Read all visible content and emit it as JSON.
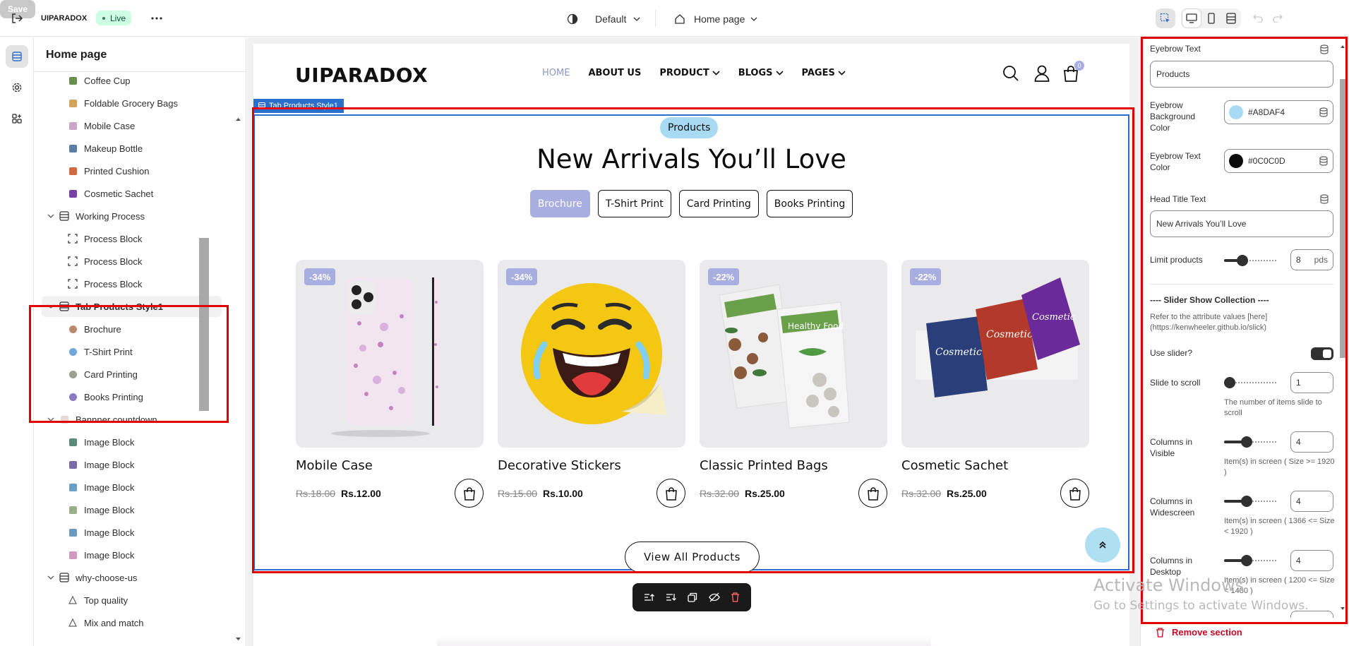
{
  "topbar": {
    "store_name": "UIPARADOX",
    "live_label": "Live",
    "theme_label": "Default",
    "page_label": "Home page",
    "save_label": "Save",
    "more_icon": "more-icon"
  },
  "sidebar": {
    "title": "Home page",
    "items": [
      {
        "label": "Coffee Cup",
        "level": 2,
        "thumb": "#6a8f4c"
      },
      {
        "label": "Foldable Grocery Bags",
        "level": 2,
        "thumb": "#d4a35b"
      },
      {
        "label": "Mobile Case",
        "level": 2,
        "thumb": "#c9a6c8"
      },
      {
        "label": "Makeup Bottle",
        "level": 2,
        "thumb": "#5b7fa3"
      },
      {
        "label": "Printed Cushion",
        "level": 2,
        "thumb": "#d06a3f"
      },
      {
        "label": "Cosmetic Sachet",
        "level": 2,
        "thumb": "#7a3fa3"
      },
      {
        "label": "Working Process",
        "level": 1,
        "icon": "section-icon"
      },
      {
        "label": "Process Block",
        "level": 2,
        "icon": "block-icon"
      },
      {
        "label": "Process Block",
        "level": 2,
        "icon": "block-icon"
      },
      {
        "label": "Process Block",
        "level": 2,
        "icon": "block-icon"
      },
      {
        "label": "Tab Products Style1",
        "level": 1,
        "icon": "section-icon",
        "selected": true
      },
      {
        "label": "Brochure",
        "level": 2,
        "thumb": "#b98a6e"
      },
      {
        "label": "T-Shirt Print",
        "level": 2,
        "thumb": "#6fa7d8"
      },
      {
        "label": "Card Printing",
        "level": 2,
        "thumb": "#9aa08c"
      },
      {
        "label": "Books Printing",
        "level": 2,
        "thumb": "#8a78c4"
      },
      {
        "label": "Bannner countdown",
        "level": 1,
        "thumb": "#e7d8d8"
      },
      {
        "label": "Image Block",
        "level": 2,
        "thumb": "#5a8a7a"
      },
      {
        "label": "Image Block",
        "level": 2,
        "thumb": "#7a6aa8"
      },
      {
        "label": "Image Block",
        "level": 2,
        "thumb": "#6aa0c8"
      },
      {
        "label": "Image Block",
        "level": 2,
        "thumb": "#9ab08a"
      },
      {
        "label": "Image Block",
        "level": 2,
        "thumb": "#6a9ac0"
      },
      {
        "label": "Image Block",
        "level": 2,
        "thumb": "#d09ac0"
      },
      {
        "label": "why-choose-us",
        "level": 1,
        "icon": "section-icon"
      },
      {
        "label": "Top quality",
        "level": 2,
        "icon": "shape-icon"
      },
      {
        "label": "Mix and match",
        "level": 2,
        "icon": "shape-icon"
      }
    ]
  },
  "preview": {
    "logo": "UIPARADOX",
    "nav": [
      {
        "label": "HOME",
        "active": true,
        "dropdown": false
      },
      {
        "label": "ABOUT US",
        "active": false,
        "dropdown": false
      },
      {
        "label": "PRODUCT",
        "active": false,
        "dropdown": true
      },
      {
        "label": "BLOGS",
        "active": false,
        "dropdown": true
      },
      {
        "label": "PAGES",
        "active": false,
        "dropdown": true
      }
    ],
    "cart_count": "0",
    "section_label": "Tab Products Style1",
    "eyebrow": "Products",
    "eyebrow_bg": "#A8DAF4",
    "eyebrow_color": "#0C0C0D",
    "title": "New Arrivals You’ll Love",
    "tabs": [
      {
        "label": "Brochure",
        "active": true
      },
      {
        "label": "T-Shirt Print",
        "active": false
      },
      {
        "label": "Card Printing",
        "active": false
      },
      {
        "label": "Books Printing",
        "active": false
      }
    ],
    "products": [
      {
        "name": "Mobile Case",
        "discount": "-34%",
        "old_price": "Rs.18.00",
        "price": "Rs.12.00",
        "image": "mobile-case-image"
      },
      {
        "name": "Decorative Stickers",
        "discount": "-34%",
        "old_price": "Rs.15.00",
        "price": "Rs.10.00",
        "image": "emoji-sticker-image"
      },
      {
        "name": "Classic Printed Bags",
        "discount": "-22%",
        "old_price": "Rs.32.00",
        "price": "Rs.25.00",
        "image": "printed-bags-image"
      },
      {
        "name": "Cosmetic Sachet",
        "discount": "-22%",
        "old_price": "Rs.32.00",
        "price": "Rs.25.00",
        "image": "cosmetic-sachet-image"
      }
    ],
    "view_all": "View All Products"
  },
  "settings": {
    "eyebrow_text_label": "Eyebrow Text",
    "eyebrow_text_value": "Products",
    "eyebrow_bg_label": "Eyebrow Background Color",
    "eyebrow_bg_value": "#A8DAF4",
    "eyebrow_text_color_label": "Eyebrow Text Color",
    "eyebrow_text_color_value": "#0C0C0D",
    "head_title_label": "Head Title Text",
    "head_title_value": "New Arrivals You’ll Love",
    "limit_label": "Limit products",
    "limit_value": "8",
    "limit_unit": "pds",
    "limit_fraction": 0.3,
    "slider_heading": "---- Slider Show Collection ----",
    "slider_desc": "Refer to the attribute values [here](https://kenwheeler.github.io/slick)",
    "use_slider_label": "Use slider?",
    "use_slider_on": true,
    "slide_scroll_label": "Slide to scroll",
    "slide_scroll_value": "1",
    "slide_scroll_fraction": 0.0,
    "slide_scroll_help": "The number of items slide to scroll",
    "col_visible_label": "Columns in Visible",
    "col_visible_value": "4",
    "col_visible_fraction": 0.4,
    "col_visible_help": "Item(s) in screen ( Size >= 1920 )",
    "col_wide_label": "Columns in Widescreen",
    "col_wide_value": "4",
    "col_wide_fraction": 0.4,
    "col_wide_help": "Item(s) in screen ( 1366 <= Size < 1920 )",
    "col_desktop_label": "Columns in Desktop",
    "col_desktop_value": "4",
    "col_desktop_fraction": 0.4,
    "col_desktop_help": "Item(s) in screen ( 1200 <= Size < 1480 )",
    "remove_label": "Remove section"
  },
  "toolbar_icons": [
    "move-up-icon",
    "move-down-icon",
    "duplicate-icon",
    "hide-icon",
    "delete-icon"
  ],
  "watermark": {
    "line1": "Activate Windows",
    "line2": "Go to Settings to activate Windows."
  }
}
